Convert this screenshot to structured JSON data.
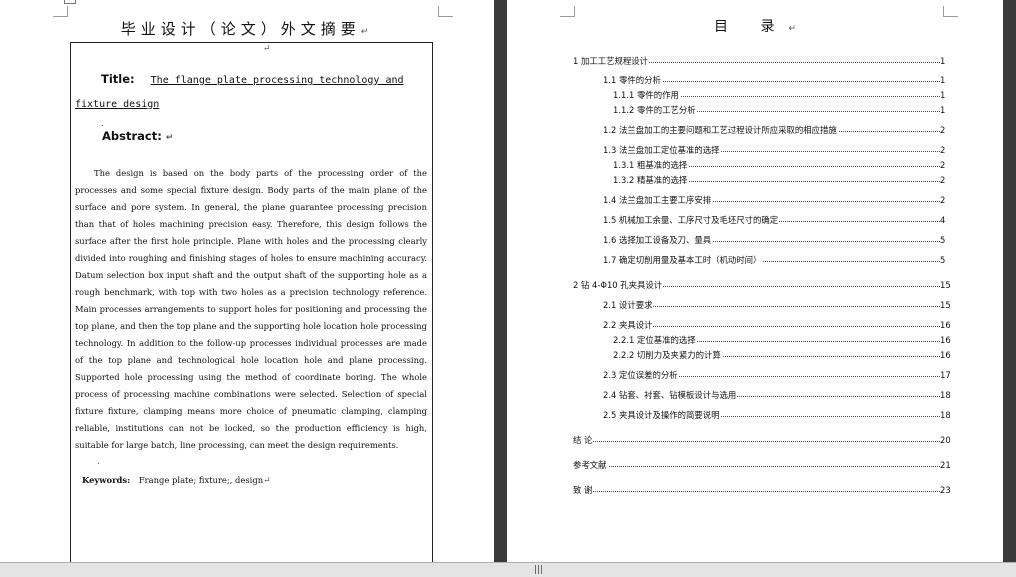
{
  "left_page": {
    "header_title": "毕业设计（论文）外文摘要",
    "title_label": "Title:",
    "title_line1": "The flange plate processing technology and",
    "title_line2": "fixture design",
    "abstract_label": "Abstract:",
    "abstract_text": "The design is based on the body parts of the processing order of the processes and some special fixture design. Body parts of the main plane of the surface and pore system. In general, the plane guarantee processing precision than that of holes machining precision easy. Therefore, this design follows the surface after the first hole principle. Plane with holes and the processing clearly divided into roughing and finishing stages of holes to ensure machining accuracy. Datum selection box input shaft and the output shaft of the supporting hole as a rough benchmark, with top with two holes as a precision technology reference. Main processes arrangements to support holes for positioning and processing the top plane, and then the top plane and the supporting hole location hole processing technology. In addition to the follow-up processes individual processes are made of the top plane and technological hole location hole and plane processing. Supported hole processing using the method of coordinate boring. The whole process of processing machine combinations were selected. Selection of special fixture fixture, clamping means more choice of pneumatic clamping, clamping reliable, institutions can not be locked, so the production efficiency is high, suitable for large batch, line processing, can meet the design requirements.",
    "keywords_label": "Keywords:",
    "keywords_value": "Frange plate; fixture;, design"
  },
  "right_page": {
    "toc_title": "目 录",
    "entries": [
      {
        "text": "1   加工工艺规程设计",
        "page": "1"
      },
      {
        "text": "1.1  零件的分析",
        "page": "1"
      },
      {
        "text": "1.1.1  零件的作用",
        "page": "1"
      },
      {
        "text": "1.1.2  零件的工艺分析",
        "page": "1"
      },
      {
        "text": "1.2  法兰盘加工的主要问题和工艺过程设计所应采取的相应措施",
        "page": "2"
      },
      {
        "text": "1.3  法兰盘加工定位基准的选择",
        "page": "2"
      },
      {
        "text": "1.3.1  粗基准的选择",
        "page": "2"
      },
      {
        "text": "1.3.2  精基准的选择",
        "page": "2"
      },
      {
        "text": "1.4  法兰盘加工主要工序安排",
        "page": "2"
      },
      {
        "text": "1.5  机械加工余量、工序尺寸及毛坯尺寸的确定",
        "page": "4"
      },
      {
        "text": "1.6 选择加工设备及刀、量具",
        "page": "5"
      },
      {
        "text": "1.7 确定切削用量及基本工时（机动时间）",
        "page": "5"
      },
      {
        "text": "2  钻 4-Φ10 孔夹具设计",
        "page": "15"
      },
      {
        "text": "2.1 设计要求",
        "page": "15"
      },
      {
        "text": "2.2 夹具设计",
        "page": "16"
      },
      {
        "text": "2.2.1    定位基准的选择",
        "page": "16"
      },
      {
        "text": "2.2.2    切削力及夹紧力的计算",
        "page": "16"
      },
      {
        "text": "2.3 定位误差的分析",
        "page": "17"
      },
      {
        "text": "2.4  钻套、衬套、钻模板设计与选用",
        "page": "18"
      },
      {
        "text": "2.5 夹具设计及操作的简要说明",
        "page": "18"
      },
      {
        "text": "结  论",
        "page": "20"
      },
      {
        "text": "参考文献",
        "page": "21"
      },
      {
        "text": "致      谢",
        "page": "23"
      }
    ]
  },
  "status_bar": {
    "grip_glyph": "|||"
  }
}
